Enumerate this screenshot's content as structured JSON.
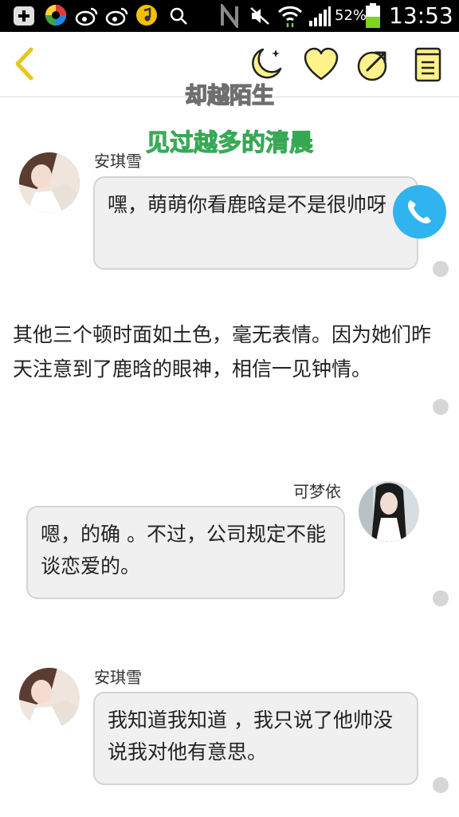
{
  "status_bar": {
    "battery": "52%",
    "time": "13:53",
    "icons": [
      "add-icon",
      "app-icon",
      "weibo-icon",
      "weibo-icon",
      "music-icon",
      "search-icon",
      "nfc-icon",
      "mute-icon",
      "wifi-icon",
      "signal-icon",
      "battery-icon"
    ]
  },
  "toolbar": {
    "icons": [
      "back-arrow-icon",
      "night-mode-icon",
      "heart-icon",
      "share-icon",
      "bookmark-icon"
    ],
    "accent": "#e8c61c"
  },
  "story": {
    "author": "却越陌生",
    "title": "见过越多的清晨"
  },
  "messages": [
    {
      "name": "安琪雪",
      "text": "嘿，萌萌你看鹿晗是不是很帅呀"
    },
    {
      "narration": "其他三个顿时面如土色，毫无表情。因为她们昨天注意到了鹿晗的眼神，相信一见钟情。"
    },
    {
      "name": "可梦依",
      "text": "嗯，的确 。不过，公司规定不能谈恋爱的。"
    },
    {
      "name": "安琪雪",
      "text": "我知道我知道 ，我只说了他帅没说我对他有意思。"
    }
  ],
  "colors": {
    "title_green": "#56cf77",
    "call_blue": "#2fb4ef",
    "bubble_bg": "#f0f0f0"
  }
}
